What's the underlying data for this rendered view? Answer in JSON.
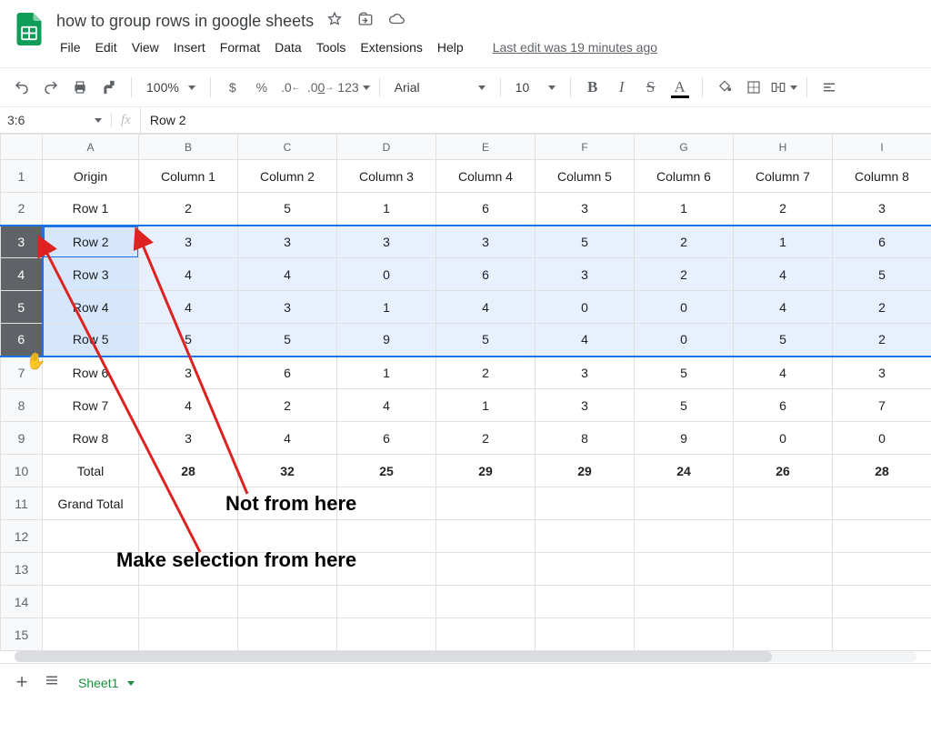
{
  "doc_title": "how to group rows in google sheets",
  "menu": [
    "File",
    "Edit",
    "View",
    "Insert",
    "Format",
    "Data",
    "Tools",
    "Extensions",
    "Help"
  ],
  "last_edit": "Last edit was 19 minutes ago",
  "toolbar": {
    "zoom": "100%",
    "currency": "$",
    "percent": "%",
    "dec_dec": ".0",
    "inc_dec": ".00",
    "more_fmt": "123",
    "font": "Arial",
    "font_size": "10"
  },
  "name_box": "3:6",
  "fx_value": "Row 2",
  "columns": [
    "A",
    "B",
    "C",
    "D",
    "E",
    "F",
    "G",
    "H",
    "I"
  ],
  "selection": {
    "start": 3,
    "end": 6
  },
  "chart_data": {
    "type": "table",
    "column_headers": [
      "Origin",
      "Column 1",
      "Column 2",
      "Column 3",
      "Column 4",
      "Column 5",
      "Column 6",
      "Column 7",
      "Column 8"
    ],
    "rows": [
      {
        "n": 1,
        "cells": [
          "Origin",
          "Column 1",
          "Column 2",
          "Column 3",
          "Column 4",
          "Column 5",
          "Column 6",
          "Column 7",
          "Column 8"
        ]
      },
      {
        "n": 2,
        "cells": [
          "Row 1",
          "2",
          "5",
          "1",
          "6",
          "3",
          "1",
          "2",
          "3"
        ]
      },
      {
        "n": 3,
        "cells": [
          "Row 2",
          "3",
          "3",
          "3",
          "3",
          "5",
          "2",
          "1",
          "6"
        ]
      },
      {
        "n": 4,
        "cells": [
          "Row 3",
          "4",
          "4",
          "0",
          "6",
          "3",
          "2",
          "4",
          "5"
        ]
      },
      {
        "n": 5,
        "cells": [
          "Row 4",
          "4",
          "3",
          "1",
          "4",
          "0",
          "0",
          "4",
          "2"
        ]
      },
      {
        "n": 6,
        "cells": [
          "Row 5",
          "5",
          "5",
          "9",
          "5",
          "4",
          "0",
          "5",
          "2"
        ]
      },
      {
        "n": 7,
        "cells": [
          "Row 6",
          "3",
          "6",
          "1",
          "2",
          "3",
          "5",
          "4",
          "3"
        ]
      },
      {
        "n": 8,
        "cells": [
          "Row 7",
          "4",
          "2",
          "4",
          "1",
          "3",
          "5",
          "6",
          "7"
        ]
      },
      {
        "n": 9,
        "cells": [
          "Row 8",
          "3",
          "4",
          "6",
          "2",
          "8",
          "9",
          "0",
          "0"
        ]
      },
      {
        "n": 10,
        "cells": [
          "Total",
          "28",
          "32",
          "25",
          "29",
          "29",
          "24",
          "26",
          "28"
        ],
        "bold": true
      },
      {
        "n": 11,
        "cells": [
          "Grand Total",
          "",
          "",
          "",
          "",
          "",
          "",
          "",
          ""
        ]
      },
      {
        "n": 12,
        "cells": [
          "",
          "",
          "",
          "",
          "",
          "",
          "",
          "",
          ""
        ]
      },
      {
        "n": 13,
        "cells": [
          "",
          "",
          "",
          "",
          "",
          "",
          "",
          "",
          ""
        ]
      },
      {
        "n": 14,
        "cells": [
          "",
          "",
          "",
          "",
          "",
          "",
          "",
          "",
          ""
        ]
      },
      {
        "n": 15,
        "cells": [
          "",
          "",
          "",
          "",
          "",
          "",
          "",
          "",
          ""
        ]
      }
    ]
  },
  "sheet_tab": "Sheet1",
  "annotations": {
    "not_from_here": "Not from here",
    "make_selection": "Make selection from here"
  }
}
